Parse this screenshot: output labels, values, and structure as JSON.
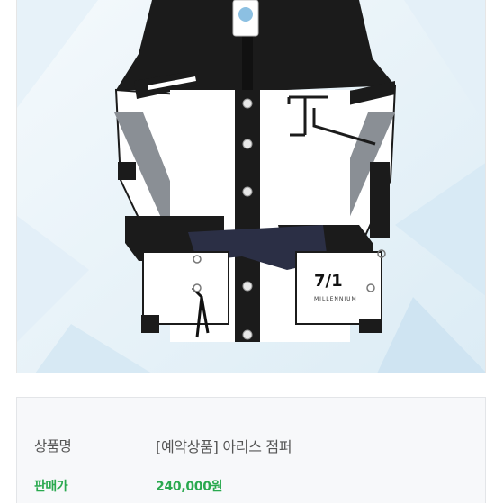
{
  "product": {
    "image_alt": "아리스 점퍼 product photo",
    "logo_mark": "7/1",
    "logo_text": "MILLENNIUM",
    "name_label": "상품명",
    "name_value": "[예약상품] 아리스 점퍼",
    "price_label": "판매가",
    "price_value": "240,000원"
  },
  "colors": {
    "accent_green": "#2aa94f",
    "label_gray": "#555555",
    "panel_bg": "#f7f8fa"
  }
}
